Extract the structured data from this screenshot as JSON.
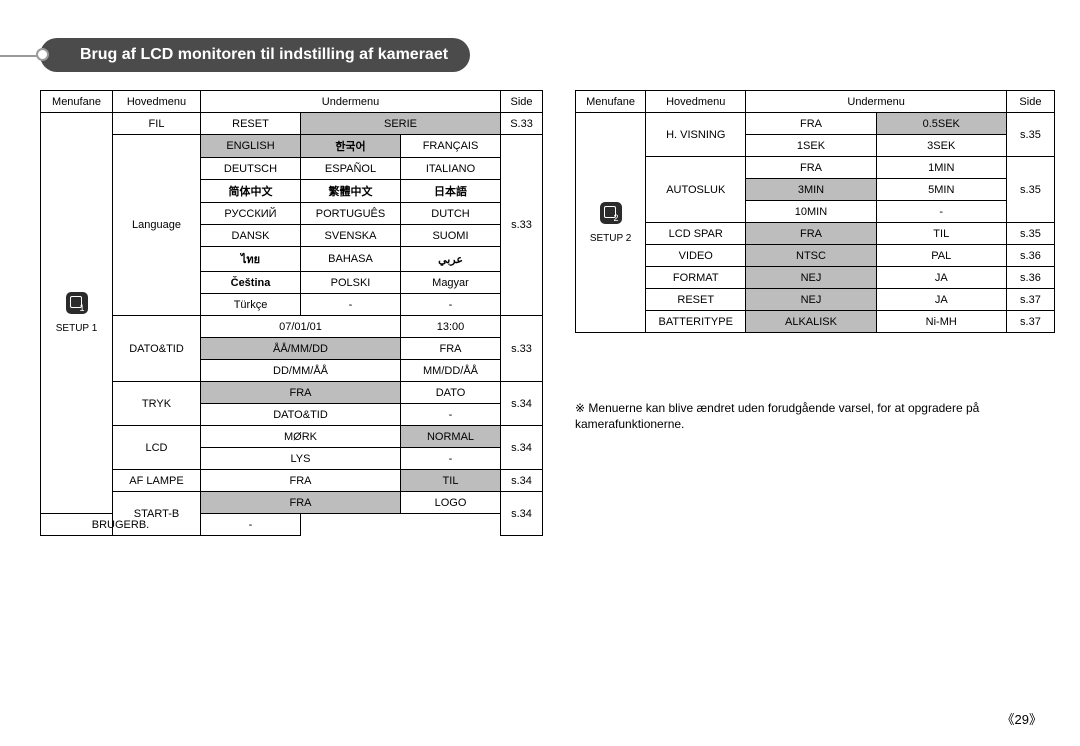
{
  "title": "Brug af LCD monitoren til indstilling af kameraet",
  "headersLeft": [
    "Menufane",
    "Hovedmenu",
    "Undermenu",
    "Side"
  ],
  "headersRight": [
    "Menufane",
    "Hovedmenu",
    "Undermenu",
    "Side"
  ],
  "setup1Label": "SETUP 1",
  "setup2Label": "SETUP 2",
  "left": {
    "fil": {
      "main": "FIL",
      "c1": "RESET",
      "c2": "SERIE",
      "side": "S.33"
    },
    "languageLabel": "Language",
    "langSide": "s.33",
    "lang": {
      "r1": [
        "ENGLISH",
        "한국어",
        "FRANÇAIS"
      ],
      "r2": [
        "DEUTSCH",
        "ESPAÑOL",
        "ITALIANO"
      ],
      "r3": [
        "简体中文",
        "繁體中文",
        "日本語"
      ],
      "r4": [
        "РУССКИЙ",
        "PORTUGUÊS",
        "DUTCH"
      ],
      "r5": [
        "DANSK",
        "SVENSKA",
        "SUOMI"
      ],
      "r6": [
        "ไทย",
        "BAHASA",
        "عربي"
      ],
      "r7": [
        "Čeština",
        "POLSKI",
        "Magyar"
      ],
      "r8": [
        "Türkçe",
        "-",
        "-"
      ]
    },
    "datoLabel": "DATO&TID",
    "datoSide": "s.33",
    "dato": {
      "r1": [
        "07/01/01",
        "13:00"
      ],
      "r2": [
        "ÅÅ/MM/DD",
        "FRA"
      ],
      "r3": [
        "DD/MM/ÅÅ",
        "MM/DD/ÅÅ"
      ]
    },
    "tryk": {
      "label": "TRYK",
      "r1": [
        "FRA",
        "DATO"
      ],
      "r2": [
        "DATO&TID",
        "-"
      ],
      "side": "s.34"
    },
    "lcd": {
      "label": "LCD",
      "r1": [
        "MØRK",
        "NORMAL"
      ],
      "r2": [
        "LYS",
        "-"
      ],
      "side": "s.34"
    },
    "afl": {
      "label": "AF LAMPE",
      "c1": "FRA",
      "c2": "TIL",
      "side": "s.34"
    },
    "startb": {
      "label": "START-B",
      "r1": [
        "FRA",
        "LOGO"
      ],
      "r2": [
        "BRUGERB.",
        "-"
      ],
      "side": "s.34"
    }
  },
  "right": {
    "hvis": {
      "label": "H. VISNING",
      "r1": [
        "FRA",
        "0.5SEK"
      ],
      "r2": [
        "1SEK",
        "3SEK"
      ],
      "side": "s.35"
    },
    "autosluk": {
      "label": "AUTOSLUK",
      "r1": [
        "FRA",
        "1MIN"
      ],
      "r2": [
        "3MIN",
        "5MIN"
      ],
      "r3": [
        "10MIN",
        "-"
      ],
      "side": "s.35"
    },
    "lcdspar": {
      "label": "LCD SPAR",
      "c1": "FRA",
      "c2": "TIL",
      "side": "s.35"
    },
    "video": {
      "label": "VIDEO",
      "c1": "NTSC",
      "c2": "PAL",
      "side": "s.36"
    },
    "format": {
      "label": "FORMAT",
      "c1": "NEJ",
      "c2": "JA",
      "side": "s.36"
    },
    "reset": {
      "label": "RESET",
      "c1": "NEJ",
      "c2": "JA",
      "side": "s.37"
    },
    "batt": {
      "label": "BATTERITYPE",
      "c1": "ALKALISK",
      "c2": "Ni-MH",
      "side": "s.37"
    }
  },
  "footnote": "Menuerne kan blive ændret uden forudgående varsel, for at opgradere på kamerafunktionerne.",
  "footnoteMark": "※",
  "pageNumber": "《29》"
}
